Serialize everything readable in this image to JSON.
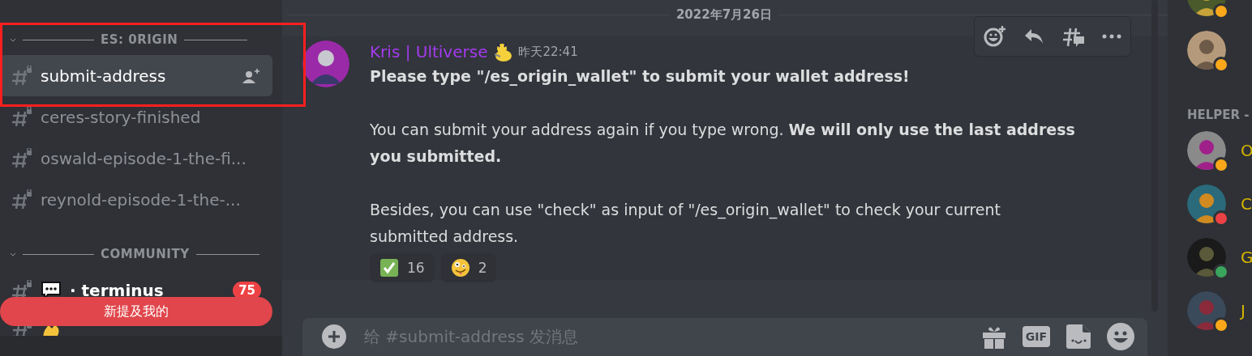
{
  "sidebar": {
    "categories": [
      {
        "title": "ES: 0RIGIN",
        "channels": [
          {
            "kind": "plain",
            "name": "submit-address",
            "selected": true,
            "unread": false
          },
          {
            "kind": "plain",
            "name": "ceres-story-finished",
            "selected": false,
            "unread": false
          },
          {
            "kind": "plain",
            "name": "oswald-episode-1-the-fi...",
            "selected": false,
            "unread": false
          },
          {
            "kind": "plain",
            "name": "reynold-episode-1-the-...",
            "selected": false,
            "unread": false
          }
        ]
      },
      {
        "title": "COMMUNITY",
        "channels": [
          {
            "kind": "speech",
            "name": "· terminus",
            "selected": false,
            "unread": true,
            "badge": "75"
          },
          {
            "kind": "wave",
            "selected": false
          }
        ]
      }
    ],
    "mentions_bar": "新提及我的"
  },
  "chat": {
    "date_divider": "2022年7月26日",
    "message": {
      "author": "Kris | Ultiverse",
      "time": "昨天22:41",
      "paragraphs": [
        "**Please type \"/es_origin_wallet\" to submit your wallet address!**",
        "You can submit your address again if you type wrong. **We will only use the last address you submitted.**",
        "Besides, you can use \"check\" as input of \"/es_origin_wallet\" to check your current submitted address."
      ],
      "reactions": [
        {
          "kind": "check",
          "count": "16"
        },
        {
          "kind": "zany",
          "count": "2"
        }
      ]
    },
    "composer": {
      "placeholder": "给 #submit-address 发消息",
      "gif_label": "GIF"
    }
  },
  "members": {
    "items": [
      {
        "kind": "member",
        "color": "#faa81a"
      },
      {
        "kind": "member",
        "color": "#faa81a"
      },
      {
        "kind": "header",
        "name": "HELPER -"
      },
      {
        "kind": "member",
        "name": "O",
        "color": "#faa81a"
      },
      {
        "kind": "member",
        "name": "C",
        "color": "#ed4245"
      },
      {
        "kind": "member",
        "name": "G",
        "color": "#3ba55d"
      },
      {
        "kind": "member",
        "name": "J",
        "color": "#faa81a"
      }
    ]
  }
}
